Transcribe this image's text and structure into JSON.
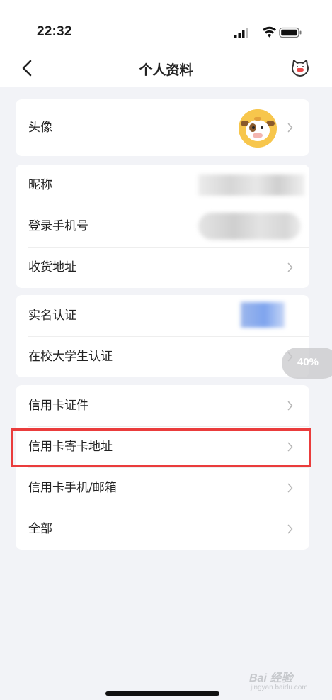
{
  "status_bar": {
    "time": "22:32"
  },
  "nav": {
    "title": "个人资料",
    "back_icon": "chevron-left-icon",
    "right_icon": "cat-service-icon"
  },
  "groups": [
    {
      "rows": [
        {
          "label": "头像",
          "chevron": true
        }
      ]
    },
    {
      "rows": [
        {
          "label": "昵称",
          "chevron": false
        },
        {
          "label": "登录手机号",
          "chevron": false
        },
        {
          "label": "收货地址",
          "chevron": true
        }
      ]
    },
    {
      "rows": [
        {
          "label": "实名认证",
          "chevron": false
        },
        {
          "label": "在校大学生认证",
          "chevron": true
        }
      ]
    },
    {
      "rows": [
        {
          "label": "信用卡证件",
          "chevron": true
        },
        {
          "label": "信用卡寄卡地址",
          "chevron": true
        },
        {
          "label": "信用卡手机/邮箱",
          "chevron": true
        },
        {
          "label": "全部",
          "chevron": true
        }
      ]
    }
  ],
  "zoom_badge": "40%",
  "watermark": {
    "main": "Bai 经验",
    "sub": "jingyan.baidu.com"
  },
  "colors": {
    "highlight": "#ea3c3c",
    "background": "#f2f3f7",
    "avatar": "#f7c64c"
  }
}
